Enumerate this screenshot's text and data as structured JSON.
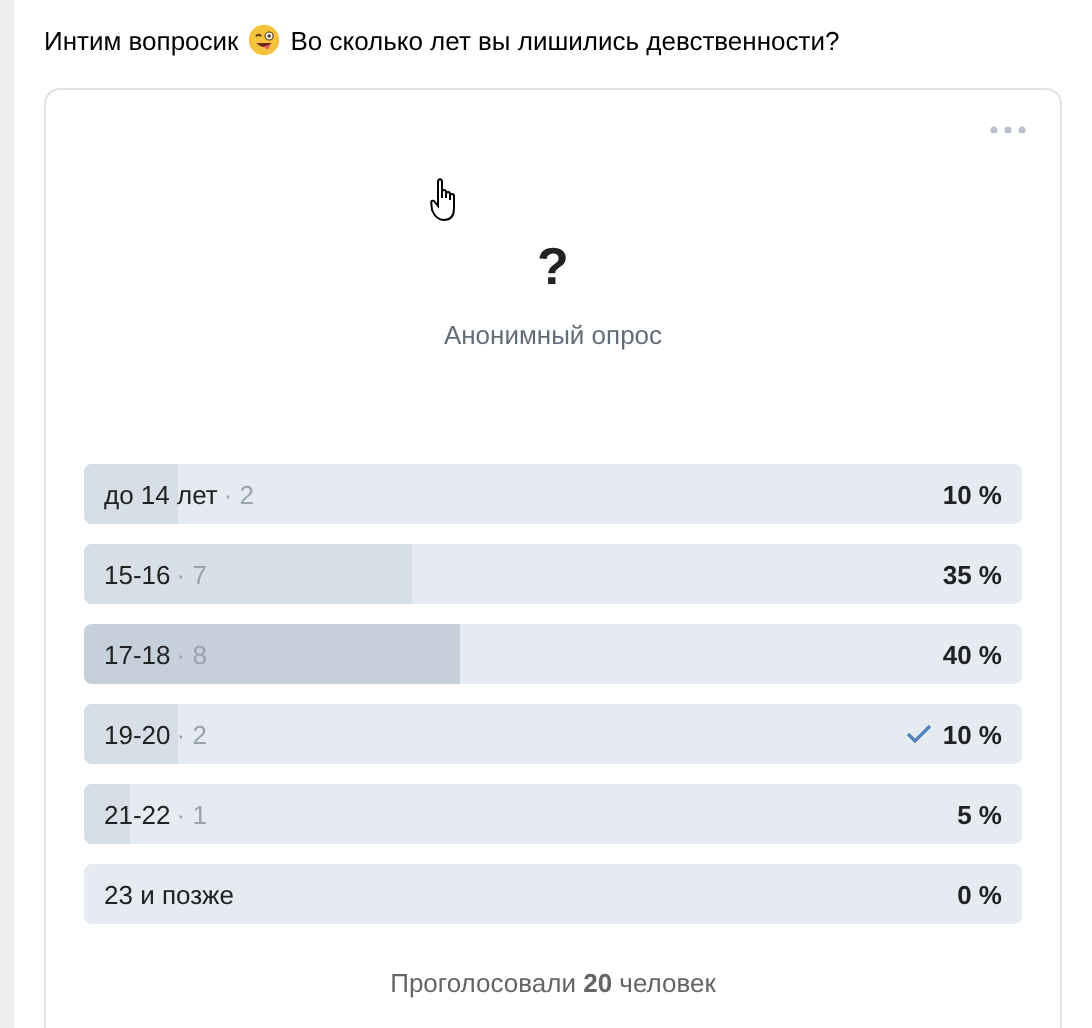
{
  "post": {
    "text_before": "Интим вопросик",
    "text_after": "Во сколько лет вы лишились девственности?"
  },
  "poll": {
    "title": "?",
    "subtitle": "Анонимный опрос",
    "options": [
      {
        "label": "до 14 лет",
        "votes": "· 2",
        "percent": "10 %",
        "level": 0.1,
        "selected": false,
        "leading": false
      },
      {
        "label": "15-16",
        "votes": "· 7",
        "percent": "35 %",
        "level": 0.35,
        "selected": false,
        "leading": false
      },
      {
        "label": "17-18",
        "votes": "· 8",
        "percent": "40 %",
        "level": 0.4,
        "selected": false,
        "leading": true
      },
      {
        "label": "19-20",
        "votes": "· 2",
        "percent": "10 %",
        "level": 0.1,
        "selected": true,
        "leading": false
      },
      {
        "label": "21-22",
        "votes": "· 1",
        "percent": "5 %",
        "level": 0.05,
        "selected": false,
        "leading": false
      },
      {
        "label": "23 и позже",
        "percent": "0 %",
        "selected": false
      }
    ],
    "footer": "Проголосовали **20** человек"
  }
}
